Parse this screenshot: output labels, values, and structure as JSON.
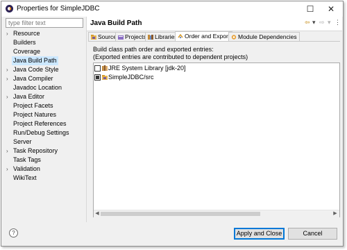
{
  "window": {
    "title": "Properties for SimpleJDBC",
    "maximize_glyph": "☐",
    "close_glyph": "✕"
  },
  "filter": {
    "placeholder": "type filter text",
    "value": ""
  },
  "nav": [
    {
      "label": "Resource",
      "expandable": true
    },
    {
      "label": "Builders",
      "expandable": false
    },
    {
      "label": "Coverage",
      "expandable": false
    },
    {
      "label": "Java Build Path",
      "expandable": false,
      "selected": true
    },
    {
      "label": "Java Code Style",
      "expandable": true
    },
    {
      "label": "Java Compiler",
      "expandable": true
    },
    {
      "label": "Javadoc Location",
      "expandable": false
    },
    {
      "label": "Java Editor",
      "expandable": true
    },
    {
      "label": "Project Facets",
      "expandable": false
    },
    {
      "label": "Project Natures",
      "expandable": false
    },
    {
      "label": "Project References",
      "expandable": false
    },
    {
      "label": "Run/Debug Settings",
      "expandable": false
    },
    {
      "label": "Server",
      "expandable": false
    },
    {
      "label": "Task Repository",
      "expandable": true
    },
    {
      "label": "Task Tags",
      "expandable": false
    },
    {
      "label": "Validation",
      "expandable": true
    },
    {
      "label": "WikiText",
      "expandable": false
    }
  ],
  "page": {
    "title": "Java Build Path",
    "back_glyph": "⇦",
    "forward_glyph": "⇨",
    "menu_glyph": "▾",
    "more_glyph": "⋮"
  },
  "tabs": [
    {
      "label": "Source",
      "icon": "source-folder-icon"
    },
    {
      "label": "Projects",
      "icon": "projects-icon"
    },
    {
      "label": "Libraries",
      "icon": "libraries-icon"
    },
    {
      "label": "Order and Export",
      "icon": "order-export-icon",
      "active": true
    },
    {
      "label": "Module Dependencies",
      "icon": "module-icon"
    }
  ],
  "description": {
    "line1": "Build class path order and exported entries:",
    "line2": "(Exported entries are contributed to dependent projects)"
  },
  "entries": [
    {
      "label": "JRE System Library [jdk-20]",
      "checked": false,
      "icon": "library-icon"
    },
    {
      "label": "SimpleJDBC/src",
      "checked": true,
      "icon": "package-folder-icon"
    }
  ],
  "scrollbar": {
    "left_glyph": "◀",
    "right_glyph": "▶"
  },
  "footer": {
    "help_glyph": "?",
    "apply_close": "Apply and Close",
    "cancel": "Cancel"
  },
  "colors": {
    "selection": "#cce8ff",
    "default_button_border": "#0078d7",
    "eclipse_purple": "#2c2255",
    "eclipse_orange": "#f7941e"
  }
}
